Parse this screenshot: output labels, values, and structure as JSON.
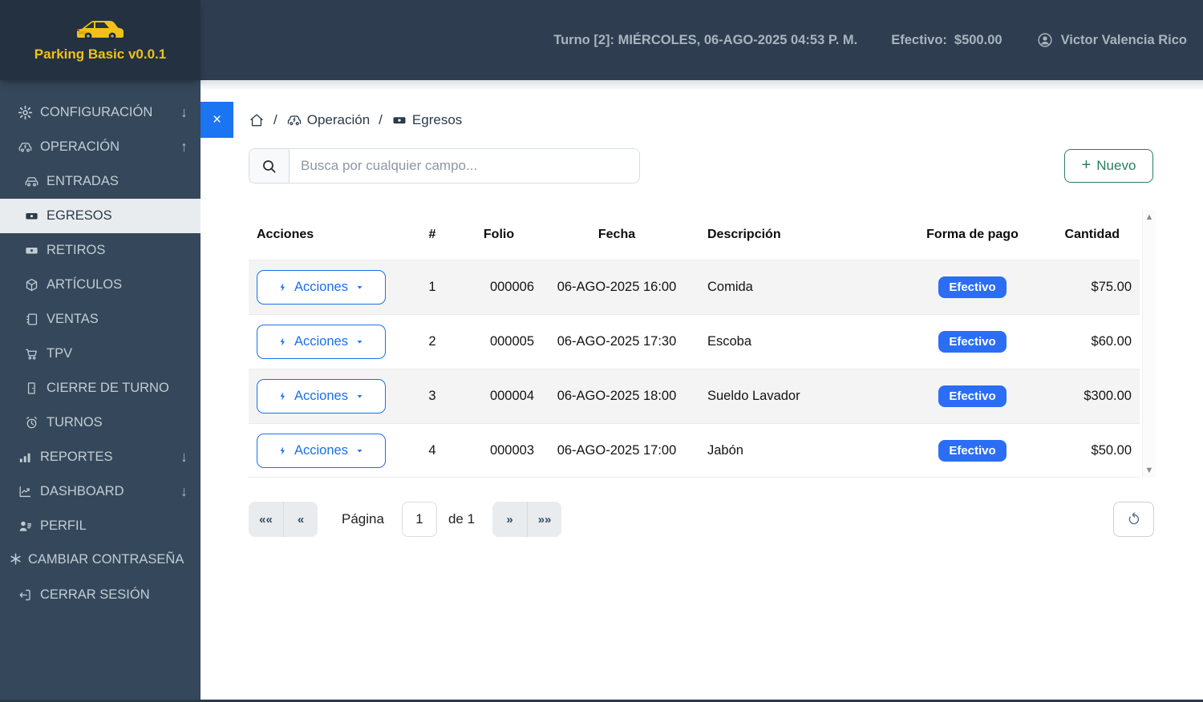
{
  "app": {
    "logo_title": "Parking Basic v0.0.1"
  },
  "topbar": {
    "turno": "Turno [2]: MIÉRCOLES, 06-AGO-2025 04:53 P. M.",
    "efectivo_label": "Efectivo:",
    "efectivo_value": "$500.00",
    "user_name": "Victor Valencia Rico"
  },
  "sidebar": {
    "items": [
      {
        "label": "CONFIGURACIÓN",
        "icon": "gear-icon",
        "arrow": "↓"
      },
      {
        "label": "OPERACIÓN",
        "icon": "car-bolt-icon",
        "arrow": "↑"
      },
      {
        "label": "ENTRADAS",
        "icon": "car-icon"
      },
      {
        "label": "EGRESOS",
        "icon": "banknote-icon",
        "active": true
      },
      {
        "label": "RETIROS",
        "icon": "banknote-icon"
      },
      {
        "label": "ARTÍCULOS",
        "icon": "cube-icon"
      },
      {
        "label": "VENTAS",
        "icon": "notebook-icon"
      },
      {
        "label": "TPV",
        "icon": "cart-icon"
      },
      {
        "label": "CIERRE DE TURNO",
        "icon": "door-icon"
      },
      {
        "label": "TURNOS",
        "icon": "alarm-icon"
      },
      {
        "label": "REPORTES",
        "icon": "barchart-icon",
        "arrow": "↓"
      },
      {
        "label": "DASHBOARD",
        "icon": "linechart-icon",
        "arrow": "↓"
      },
      {
        "label": "PERFIL",
        "icon": "person-icon"
      },
      {
        "label": "CAMBIAR CONTRASEÑA",
        "icon": "asterisk-icon"
      },
      {
        "label": "CERRAR SESIÓN",
        "icon": "logout-icon"
      }
    ]
  },
  "content": {
    "close_glyph": "×",
    "breadcrumb": {
      "separator": "/",
      "operacion": "Operación",
      "egresos": "Egresos"
    },
    "search": {
      "placeholder": "Busca por cualquier campo..."
    },
    "new_button": {
      "plus": "+",
      "label": "Nuevo"
    }
  },
  "table": {
    "headers": [
      "Acciones",
      "#",
      "Folio",
      "Fecha",
      "Descripción",
      "Forma de pago",
      "Cantidad"
    ],
    "actions_button_label": "Acciones",
    "rows": [
      {
        "num": "1",
        "folio": "000006",
        "fecha": "06-AGO-2025 16:00",
        "descripcion": "Comida",
        "forma_pago": "Efectivo",
        "cantidad": "$75.00"
      },
      {
        "num": "2",
        "folio": "000005",
        "fecha": "06-AGO-2025 17:30",
        "descripcion": "Escoba",
        "forma_pago": "Efectivo",
        "cantidad": "$60.00"
      },
      {
        "num": "3",
        "folio": "000004",
        "fecha": "06-AGO-2025 18:00",
        "descripcion": "Sueldo Lavador",
        "forma_pago": "Efectivo",
        "cantidad": "$300.00"
      },
      {
        "num": "4",
        "folio": "000003",
        "fecha": "06-AGO-2025 17:00",
        "descripcion": "Jabón",
        "forma_pago": "Efectivo",
        "cantidad": "$50.00"
      }
    ],
    "scrollbar": {
      "up_glyph": "▲",
      "down_glyph": "▼"
    }
  },
  "pagination": {
    "first": "««",
    "prev": "«",
    "page_label": "Página",
    "page_value": "1",
    "of_label": "de 1",
    "next": "»",
    "last": "»»"
  },
  "colors": {
    "sidebar_bg": "#35485b",
    "logo_bg": "#233140",
    "topbar_bg": "#2e3d4f",
    "brand_yellow": "#f0c11a",
    "accent_blue": "#2b6ef5",
    "action_blue": "#1a6ff0",
    "close_blue": "#1b74f2",
    "new_green": "#2a7d62",
    "active_item_bg": "#e9ecef",
    "row_alt_bg": "#f4f4f4"
  }
}
